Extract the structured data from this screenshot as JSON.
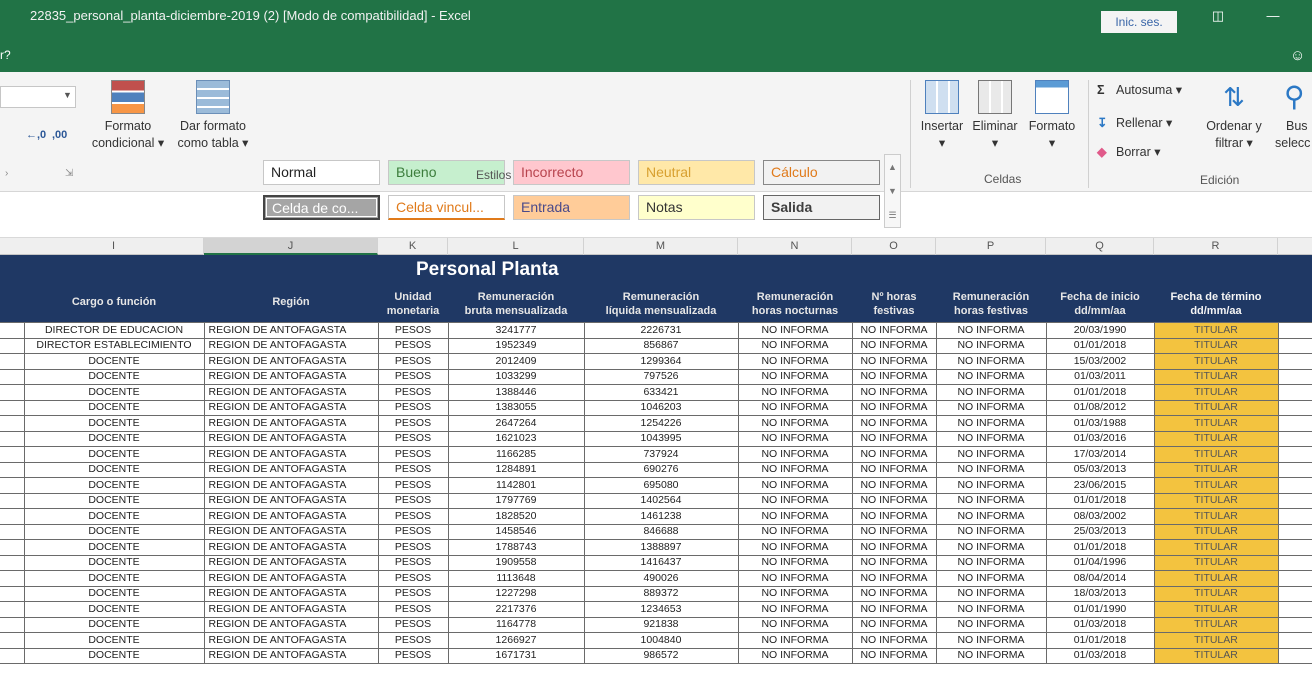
{
  "window": {
    "title": "22835_personal_planta-diciembre-2019 (2)  [Modo de compatibilidad]  -  Excel",
    "signin_label": "Inic. ses.",
    "tell_me": "r?"
  },
  "ribbon": {
    "conditional_format": [
      "Formato",
      "condicional"
    ],
    "format_as_table": [
      "Dar formato",
      "como tabla"
    ],
    "styles": {
      "group_label": "Estilos",
      "cells": [
        {
          "label": "Normal",
          "bg": "#ffffff",
          "color": "#222222"
        },
        {
          "label": "Bueno",
          "bg": "#c6efce",
          "color": "#3c7d3c"
        },
        {
          "label": "Incorrecto",
          "bg": "#ffc7ce",
          "color": "#b8444e"
        },
        {
          "label": "Neutral",
          "bg": "#ffe8a8",
          "color": "#d8a030"
        },
        {
          "label": "Cálculo",
          "bg": "#f2f2f2",
          "color": "#e07a1a"
        },
        {
          "label": "Celda de co...",
          "bg": "#a5a5a5",
          "color": "#ffffff"
        },
        {
          "label": "Celda vincul...",
          "bg": "#ffffff",
          "color": "#e07a1a"
        },
        {
          "label": "Entrada",
          "bg": "#ffcc99",
          "color": "#4a4a8a"
        },
        {
          "label": "Notas",
          "bg": "#ffffcc",
          "color": "#333333"
        },
        {
          "label": "Salida",
          "bg": "#f2f2f2",
          "color": "#3f3f3f"
        }
      ]
    },
    "cells_group": {
      "group_label": "Celdas",
      "insert": "Insertar",
      "delete": "Eliminar",
      "format": "Formato"
    },
    "editing": {
      "group_label": "Edición",
      "autosum": "Autosuma",
      "fill": "Rellenar",
      "clear": "Borrar",
      "sort_filter": [
        "Ordenar y",
        "filtrar"
      ],
      "find_select": [
        "Bus",
        "selecc"
      ]
    }
  },
  "columns": [
    "I",
    "J",
    "K",
    "L",
    "M",
    "N",
    "O",
    "P",
    "Q",
    "R"
  ],
  "sheet": {
    "banner": "Personal Planta",
    "headers": [
      [
        "Cargo o función"
      ],
      [
        "Región"
      ],
      [
        "Unidad",
        "monetaria"
      ],
      [
        "Remuneración",
        "bruta mensualizada"
      ],
      [
        "Remuneración",
        "líquida mensualizada"
      ],
      [
        "Remuneración",
        "horas nocturnas"
      ],
      [
        "Nº horas",
        "festivas"
      ],
      [
        "Remuneración",
        "horas festivas"
      ],
      [
        "Fecha de inicio",
        "dd/mm/aa"
      ],
      [
        "Fecha de término",
        "dd/mm/aa"
      ]
    ],
    "rows": [
      [
        "DIRECTOR DE EDUCACION",
        "REGION DE ANTOFAGASTA",
        "PESOS",
        "3241777",
        "2226731",
        "NO INFORMA",
        "NO INFORMA",
        "NO INFORMA",
        "20/03/1990",
        "TITULAR"
      ],
      [
        "DIRECTOR ESTABLECIMIENTO",
        "REGION DE ANTOFAGASTA",
        "PESOS",
        "1952349",
        "856867",
        "NO INFORMA",
        "NO INFORMA",
        "NO INFORMA",
        "01/01/2018",
        "TITULAR"
      ],
      [
        "DOCENTE",
        "REGION DE ANTOFAGASTA",
        "PESOS",
        "2012409",
        "1299364",
        "NO INFORMA",
        "NO INFORMA",
        "NO INFORMA",
        "15/03/2002",
        "TITULAR"
      ],
      [
        "DOCENTE",
        "REGION DE ANTOFAGASTA",
        "PESOS",
        "1033299",
        "797526",
        "NO INFORMA",
        "NO INFORMA",
        "NO INFORMA",
        "01/03/2011",
        "TITULAR"
      ],
      [
        "DOCENTE",
        "REGION DE ANTOFAGASTA",
        "PESOS",
        "1388446",
        "633421",
        "NO INFORMA",
        "NO INFORMA",
        "NO INFORMA",
        "01/01/2018",
        "TITULAR"
      ],
      [
        "DOCENTE",
        "REGION DE ANTOFAGASTA",
        "PESOS",
        "1383055",
        "1046203",
        "NO INFORMA",
        "NO INFORMA",
        "NO INFORMA",
        "01/08/2012",
        "TITULAR"
      ],
      [
        "DOCENTE",
        "REGION DE ANTOFAGASTA",
        "PESOS",
        "2647264",
        "1254226",
        "NO INFORMA",
        "NO INFORMA",
        "NO INFORMA",
        "01/03/1988",
        "TITULAR"
      ],
      [
        "DOCENTE",
        "REGION DE ANTOFAGASTA",
        "PESOS",
        "1621023",
        "1043995",
        "NO INFORMA",
        "NO INFORMA",
        "NO INFORMA",
        "01/03/2016",
        "TITULAR"
      ],
      [
        "DOCENTE",
        "REGION DE ANTOFAGASTA",
        "PESOS",
        "1166285",
        "737924",
        "NO INFORMA",
        "NO INFORMA",
        "NO INFORMA",
        "17/03/2014",
        "TITULAR"
      ],
      [
        "DOCENTE",
        "REGION DE ANTOFAGASTA",
        "PESOS",
        "1284891",
        "690276",
        "NO INFORMA",
        "NO INFORMA",
        "NO INFORMA",
        "05/03/2013",
        "TITULAR"
      ],
      [
        "DOCENTE",
        "REGION DE ANTOFAGASTA",
        "PESOS",
        "1142801",
        "695080",
        "NO INFORMA",
        "NO INFORMA",
        "NO INFORMA",
        "23/06/2015",
        "TITULAR"
      ],
      [
        "DOCENTE",
        "REGION DE ANTOFAGASTA",
        "PESOS",
        "1797769",
        "1402564",
        "NO INFORMA",
        "NO INFORMA",
        "NO INFORMA",
        "01/01/2018",
        "TITULAR"
      ],
      [
        "DOCENTE",
        "REGION DE ANTOFAGASTA",
        "PESOS",
        "1828520",
        "1461238",
        "NO INFORMA",
        "NO INFORMA",
        "NO INFORMA",
        "08/03/2002",
        "TITULAR"
      ],
      [
        "DOCENTE",
        "REGION DE ANTOFAGASTA",
        "PESOS",
        "1458546",
        "846688",
        "NO INFORMA",
        "NO INFORMA",
        "NO INFORMA",
        "25/03/2013",
        "TITULAR"
      ],
      [
        "DOCENTE",
        "REGION DE ANTOFAGASTA",
        "PESOS",
        "1788743",
        "1388897",
        "NO INFORMA",
        "NO INFORMA",
        "NO INFORMA",
        "01/01/2018",
        "TITULAR"
      ],
      [
        "DOCENTE",
        "REGION DE ANTOFAGASTA",
        "PESOS",
        "1909558",
        "1416437",
        "NO INFORMA",
        "NO INFORMA",
        "NO INFORMA",
        "01/04/1996",
        "TITULAR"
      ],
      [
        "DOCENTE",
        "REGION DE ANTOFAGASTA",
        "PESOS",
        "1113648",
        "490026",
        "NO INFORMA",
        "NO INFORMA",
        "NO INFORMA",
        "08/04/2014",
        "TITULAR"
      ],
      [
        "DOCENTE",
        "REGION DE ANTOFAGASTA",
        "PESOS",
        "1227298",
        "889372",
        "NO INFORMA",
        "NO INFORMA",
        "NO INFORMA",
        "18/03/2013",
        "TITULAR"
      ],
      [
        "DOCENTE",
        "REGION DE ANTOFAGASTA",
        "PESOS",
        "2217376",
        "1234653",
        "NO INFORMA",
        "NO INFORMA",
        "NO INFORMA",
        "01/01/1990",
        "TITULAR"
      ],
      [
        "DOCENTE",
        "REGION DE ANTOFAGASTA",
        "PESOS",
        "1164778",
        "921838",
        "NO INFORMA",
        "NO INFORMA",
        "NO INFORMA",
        "01/03/2018",
        "TITULAR"
      ],
      [
        "DOCENTE",
        "REGION DE ANTOFAGASTA",
        "PESOS",
        "1266927",
        "1004840",
        "NO INFORMA",
        "NO INFORMA",
        "NO INFORMA",
        "01/01/2018",
        "TITULAR"
      ],
      [
        "DOCENTE",
        "REGION DE ANTOFAGASTA",
        "PESOS",
        "1671731",
        "986572",
        "NO INFORMA",
        "NO INFORMA",
        "NO INFORMA",
        "01/03/2018",
        "TITULAR"
      ]
    ]
  }
}
